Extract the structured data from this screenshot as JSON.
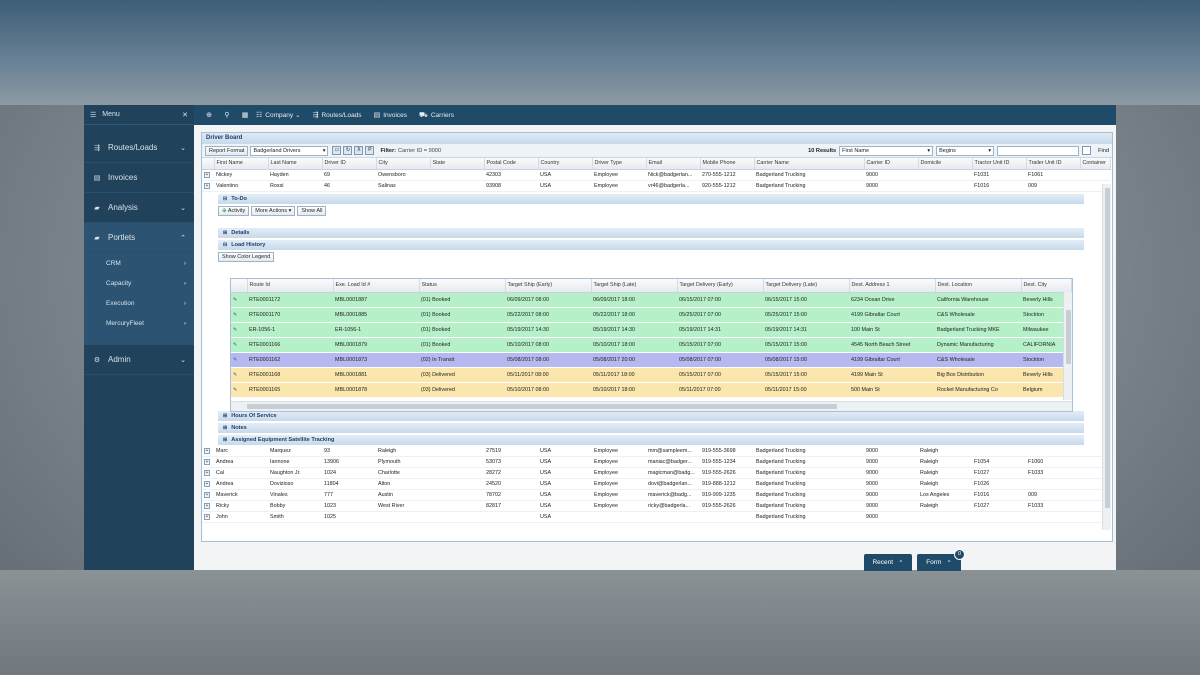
{
  "sidebar": {
    "menu_label": "Menu",
    "items": [
      {
        "label": "Routes/Loads",
        "icon": "routes-icon"
      },
      {
        "label": "Invoices",
        "icon": "invoice-icon"
      },
      {
        "label": "Analysis",
        "icon": "folder-icon"
      },
      {
        "label": "Portlets",
        "icon": "folder-icon"
      }
    ],
    "sub_items": [
      "CRM",
      "Capacity",
      "Execution",
      "MercuryFleet"
    ],
    "admin_label": "Admin"
  },
  "toolbar": {
    "company": "Company",
    "routes": "Routes/Loads",
    "invoices": "Invoices",
    "carriers": "Carriers"
  },
  "board": {
    "title": "Driver Board",
    "report_format": "Report Format",
    "report_select": "Badgerland Drivers",
    "filter_label": "Filter:",
    "filter_value": "Carrier ID = 9000",
    "results": "10 Results",
    "search_field": "First Name",
    "search_op": "Begins",
    "find": "Find"
  },
  "driver_columns": [
    "First Name",
    "Last Name",
    "Driver ID",
    "City",
    "State",
    "Postal Code",
    "Country",
    "Driver Type",
    "Email",
    "Mobile Phone",
    "Carrier Name",
    "Carrier ID",
    "Domicile",
    "Tractor Unit ID",
    "Trailer Unit ID",
    "Container"
  ],
  "drivers_top": [
    [
      "Nickey",
      "Hayden",
      "69",
      "Owensboro",
      "",
      "42303",
      "USA",
      "Employee",
      "Nick@badgerlan...",
      "270-555-1212",
      "Badgerland Trucking",
      "9000",
      "",
      "F1031",
      "F1061"
    ],
    [
      "Valentino",
      "Rossi",
      "46",
      "Salinas",
      "",
      "93908",
      "USA",
      "Employee",
      "vr46@badgerla...",
      "920-555-1212",
      "Badgerland Trucking",
      "9000",
      "",
      "F1016",
      "009"
    ]
  ],
  "sections": {
    "todo": "To-Do",
    "activity": "Activity",
    "more_actions": "More Actions",
    "show_all": "Show All",
    "details": "Details",
    "load_history": "Load History",
    "show_color_legend": "Show Color Legend",
    "hours": "Hours Of Service",
    "notes": "Notes",
    "satellite": "Assigned Equipment Satellite Tracking"
  },
  "load_columns": [
    "Route Id",
    "Exe. Load Id #",
    "Status",
    "Target Ship (Early)",
    "Target Ship (Late)",
    "Target Delivery (Early)",
    "Target Delivery (Late)",
    "Dest. Address 1",
    "Dest. Location",
    "Dest. City"
  ],
  "loads": [
    {
      "status_class": "green",
      "cells": [
        "RTE0001172",
        "MBL0001887",
        "(01) Booked",
        "06/09/2017 08:00",
        "06/09/2017 18:00",
        "06/15/2017 07:00",
        "06/15/2017 15:00",
        "6234 Ocean Drive",
        "California Warehouse",
        "Beverly Hills"
      ]
    },
    {
      "status_class": "green",
      "cells": [
        "RTE0001170",
        "MBL0001885",
        "(01) Booked",
        "05/22/2017 08:00",
        "05/22/2017 18:00",
        "05/25/2017 07:00",
        "05/25/2017 15:00",
        "4199 Gibraltar Court",
        "C&S Wholesale",
        "Stockton"
      ]
    },
    {
      "status_class": "green",
      "cells": [
        "ER-1056-1",
        "ER-1056-1",
        "(01) Booked",
        "05/19/2017 14:30",
        "05/19/2017 14:30",
        "05/19/2017 14:31",
        "05/19/2017 14:31",
        "100 Main St",
        "Badgerland Trucking MKE",
        "Milwaukee"
      ]
    },
    {
      "status_class": "green",
      "cells": [
        "RTE0001166",
        "MBL0001879",
        "(01) Booked",
        "05/10/2017 08:00",
        "05/10/2017 18:00",
        "05/15/2017 07:00",
        "05/15/2017 15:00",
        "4545 North Beach Street",
        "Dynamic Manufacturing",
        "CALIFORNIA"
      ]
    },
    {
      "status_class": "blue",
      "cells": [
        "RTE0001162",
        "MBL0001873",
        "(02) In Transit",
        "05/08/2017 08:00",
        "05/08/2017 20:00",
        "05/08/2017 07:00",
        "05/08/2017 15:00",
        "4199 Gibraltar Court",
        "C&S Wholesale",
        "Stockton"
      ]
    },
    {
      "status_class": "yellow",
      "cells": [
        "RTE0001168",
        "MBL0001881",
        "(03) Delivered",
        "05/11/2017 08:00",
        "05/11/2017 18:00",
        "05/15/2017 07:00",
        "05/15/2017 15:00",
        "4199 Main St",
        "Big Box Distribution",
        "Beverly Hills"
      ]
    },
    {
      "status_class": "yellow",
      "cells": [
        "RTE0001165",
        "MBL0001878",
        "(03) Delivered",
        "05/10/2017 08:00",
        "05/10/2017 18:00",
        "05/11/2017 07:00",
        "05/11/2017 15:00",
        "500 Main St",
        "Rocket Manufacturing Co",
        "Belgium"
      ]
    }
  ],
  "drivers_bottom": [
    [
      "Marc",
      "Marquez",
      "93",
      "Raleigh",
      "",
      "27519",
      "USA",
      "Employee",
      "mm@sampleem...",
      "919-555-3698",
      "Badgerland Trucking",
      "9000",
      "Raleigh",
      "",
      ""
    ],
    [
      "Andrea",
      "Iannone",
      "13906",
      "Plymouth",
      "",
      "53073",
      "USA",
      "Employee",
      "maniac@badger...",
      "919-555-1234",
      "Badgerland Trucking",
      "9000",
      "Raleigh",
      "F1054",
      "F1060"
    ],
    [
      "Cal",
      "Naughton Jr.",
      "1024",
      "Charlotte",
      "",
      "28272",
      "USA",
      "Employee",
      "magicman@badg...",
      "919-555-2626",
      "Badgerland Trucking",
      "9000",
      "Raleigh",
      "F1027",
      "F1033"
    ],
    [
      "Andrea",
      "Dovizioso",
      "11804",
      "Alton",
      "",
      "24520",
      "USA",
      "Employee",
      "dovi@badgerlan...",
      "919-888-1212",
      "Badgerland Trucking",
      "9000",
      "Raleigh",
      "F1026",
      ""
    ],
    [
      "Maverick",
      "Vinales",
      "777",
      "Austin",
      "",
      "78702",
      "USA",
      "Employee",
      "maverick@badg...",
      "919-999-1235",
      "Badgerland Trucking",
      "9000",
      "Los Angeles",
      "F1016",
      "009"
    ],
    [
      "Ricky",
      "Bobby",
      "1023",
      "West River",
      "",
      "82817",
      "USA",
      "Employee",
      "ricky@badgerla...",
      "919-555-2626",
      "Badgerland Trucking",
      "9000",
      "Raleigh",
      "F1027",
      "F1033"
    ],
    [
      "John",
      "Smith",
      "1025",
      "",
      "",
      "",
      "USA",
      "",
      "",
      "",
      "Badgerland Trucking",
      "9000",
      "",
      "",
      ""
    ]
  ],
  "footer": {
    "recent": "Recent",
    "form": "Form",
    "form_badge": "0"
  },
  "colors": {
    "sidebar": "#20425b",
    "toolbar": "#1f4a68",
    "booked": "#b6f0c8",
    "in_transit": "#b5b9ef",
    "delivered": "#fbe6ad"
  }
}
